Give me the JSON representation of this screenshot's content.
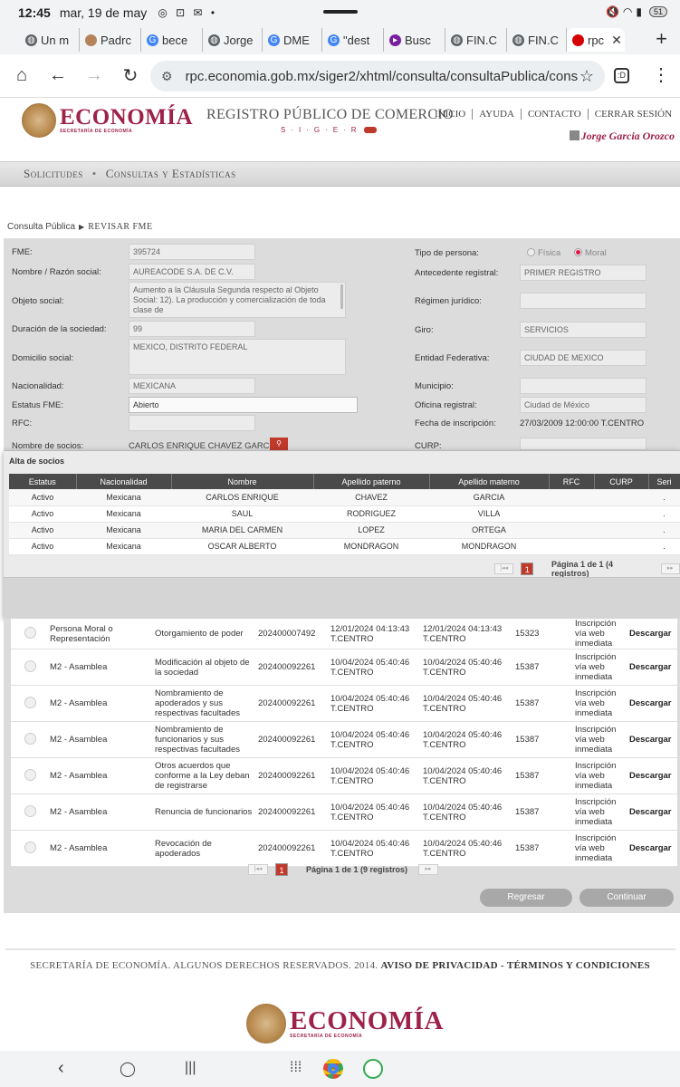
{
  "status_bar": {
    "time": "12:45",
    "date": "mar, 19 de may",
    "battery": "51"
  },
  "tabs": [
    {
      "label": "Un m",
      "color": "#5f6368"
    },
    {
      "label": "Padrc",
      "color": "#b5835a"
    },
    {
      "label": "bece",
      "color": "#4285f4"
    },
    {
      "label": "Jorge",
      "color": "#5f6368"
    },
    {
      "label": "DME",
      "color": "#4285f4"
    },
    {
      "label": "\"dest",
      "color": "#4285f4"
    },
    {
      "label": "Busc",
      "color": "#7b1fa2"
    },
    {
      "label": "FIN.C",
      "color": "#5f6368"
    },
    {
      "label": "FIN.C",
      "color": "#5f6368"
    },
    {
      "label": "rpc",
      "color": "#d50000"
    }
  ],
  "address_bar": {
    "url": "rpc.economia.gob.mx/siger2/xhtml/consulta/consultaPublica/cons",
    "tab_count": ":D"
  },
  "header": {
    "logo_text": "ECONOMÍA",
    "logo_sub": "SECRETARÍA DE ECONOMÍA",
    "title": "REGISTRO PÚBLICO DE COMERCIO",
    "siger": "S·I·G·E·R",
    "nav": [
      "INICIO",
      "AYUDA",
      "CONTACTO",
      "CERRAR SESIÓN"
    ],
    "user": "Jorge Garcia Orozco"
  },
  "menu": {
    "item1": "Solicitudes",
    "item2": "Consultas y Estadísticas"
  },
  "breadcrumb": {
    "root": "Consulta Pública",
    "current": "REVISAR FME"
  },
  "form": {
    "fme_label": "FME:",
    "fme": "395724",
    "nombre_label": "Nombre / Razón social:",
    "nombre": "AUREACODE S.A. DE C.V.",
    "objeto_label": "Objeto social:",
    "objeto": "Aumento a la Cláusula Segunda respecto al Objeto Social: 12). La producción y comercialización de toda clase de",
    "duracion_label": "Duración de la sociedad:",
    "duracion": "99",
    "domicilio_label": "Domicilio social:",
    "domicilio": "MEXICO, DISTRITO FEDERAL",
    "nacionalidad_label": "Nacionalidad:",
    "nacionalidad": "MEXICANA",
    "estatus_label": "Estatus FME:",
    "estatus": "Abierto",
    "rfc_label": "RFC:",
    "socios_label": "Nombre de socios:",
    "socios": "CARLOS ENRIQUE CHAVEZ GARCIA",
    "tipo_label": "Tipo de persona:",
    "fisica": "Física",
    "moral": "Moral",
    "antecedente_label": "Antecedente registral:",
    "antecedente": "PRIMER REGISTRO",
    "regimen_label": "Régimen jurídico:",
    "giro_label": "Giro:",
    "giro": "SERVICIOS",
    "entidad_label": "Entidad Federativa:",
    "entidad": "CIUDAD DE MEXICO",
    "municipio_label": "Municipio:",
    "oficina_label": "Oficina registral:",
    "oficina": "Ciudad de México",
    "fecha_label": "Fecha de inscripción:",
    "fecha": "27/03/2009 12:00:00 T.CENTRO",
    "curp_label": "CURP:"
  },
  "modal": {
    "title": "Alta de socios",
    "columns": [
      "Estatus",
      "Nacionalidad",
      "Nombre",
      "Apellido paterno",
      "Apellido materno",
      "RFC",
      "CURP",
      "Seri"
    ],
    "rows": [
      [
        "Activo",
        "Mexicana",
        "CARLOS ENRIQUE",
        "CHAVEZ",
        "GARCIA",
        "",
        "",
        "."
      ],
      [
        "Activo",
        "Mexicana",
        "SAUL",
        "RODRIGUEZ",
        "VILLA",
        "",
        "",
        "."
      ],
      [
        "Activo",
        "Mexicana",
        "MARIA DEL CARMEN",
        "LOPEZ",
        "ORTEGA",
        "",
        "",
        "."
      ],
      [
        "Activo",
        "Mexicana",
        "OSCAR ALBERTO",
        "MONDRAGON",
        "MONDRAGON",
        "",
        "",
        "."
      ]
    ],
    "pager": {
      "first": "|◂◂",
      "page": "1",
      "text": "Página 1 de 1 (4 registros)",
      "next": "▸▸"
    }
  },
  "acts": {
    "rows": [
      {
        "tipo": "Persona Moral o Representación",
        "acto": "Otorgamiento de poder",
        "folio": "202400007492",
        "fecha1": "12/01/2024 04:13:43 T.CENTRO",
        "fecha2": "12/01/2024 04:13:43 T.CENTRO",
        "num": "15323",
        "medio": "Inscripción vía web inmediata",
        "accion": "Descargar"
      },
      {
        "tipo": "M2 - Asamblea",
        "acto": "Modificación al objeto de la sociedad",
        "folio": "202400092261",
        "fecha1": "10/04/2024 05:40:46 T.CENTRO",
        "fecha2": "10/04/2024 05:40:46 T.CENTRO",
        "num": "15387",
        "medio": "Inscripción vía web inmediata",
        "accion": "Descargar"
      },
      {
        "tipo": "M2 - Asamblea",
        "acto": "Nombramiento de apoderados y sus respectivas facultades",
        "folio": "202400092261",
        "fecha1": "10/04/2024 05:40:46 T.CENTRO",
        "fecha2": "10/04/2024 05:40:46 T.CENTRO",
        "num": "15387",
        "medio": "Inscripción vía web inmediata",
        "accion": "Descargar"
      },
      {
        "tipo": "M2 - Asamblea",
        "acto": "Nombramiento de funcionarios y sus respectivas facultades",
        "folio": "202400092261",
        "fecha1": "10/04/2024 05:40:46 T.CENTRO",
        "fecha2": "10/04/2024 05:40:46 T.CENTRO",
        "num": "15387",
        "medio": "Inscripción vía web inmediata",
        "accion": "Descargar"
      },
      {
        "tipo": "M2 - Asamblea",
        "acto": "Otros acuerdos que conforme a la Ley deban de registrarse",
        "folio": "202400092261",
        "fecha1": "10/04/2024 05:40:46 T.CENTRO",
        "fecha2": "10/04/2024 05:40:46 T.CENTRO",
        "num": "15387",
        "medio": "Inscripción vía web inmediata",
        "accion": "Descargar"
      },
      {
        "tipo": "M2 - Asamblea",
        "acto": "Renuncia de funcionarios",
        "folio": "202400092261",
        "fecha1": "10/04/2024 05:40:46 T.CENTRO",
        "fecha2": "10/04/2024 05:40:46 T.CENTRO",
        "num": "15387",
        "medio": "Inscripción vía web inmediata",
        "accion": "Descargar"
      },
      {
        "tipo": "M2 - Asamblea",
        "acto": "Revocación de apoderados",
        "folio": "202400092261",
        "fecha1": "10/04/2024 05:40:46 T.CENTRO",
        "fecha2": "10/04/2024 05:40:46 T.CENTRO",
        "num": "15387",
        "medio": "Inscripción vía web inmediata",
        "accion": "Descargar"
      }
    ],
    "pager": {
      "first": "|◂◂",
      "page": "1",
      "text": "Página 1 de 1 (9 registros)",
      "next": "▸▸"
    },
    "btn_back": "Regresar",
    "btn_next": "Continuar"
  },
  "footer": {
    "copyright": "SECRETARÍA DE ECONOMÍA. ALGUNOS DERECHOS RESERVADOS. 2014.",
    "privacy": "AVISO DE PRIVACIDAD",
    "dash": "-",
    "terms": "TÉRMINOS Y CONDICIONES",
    "logo_text": "ECONOMÍA",
    "logo_sub": "SECRETARÍA DE ECONOMÍA"
  },
  "colors": {
    "brand": "#9d2148",
    "accent_red": "#c0392b",
    "header_dark": "#4a4a4a",
    "panel": "#dcdcdc"
  }
}
